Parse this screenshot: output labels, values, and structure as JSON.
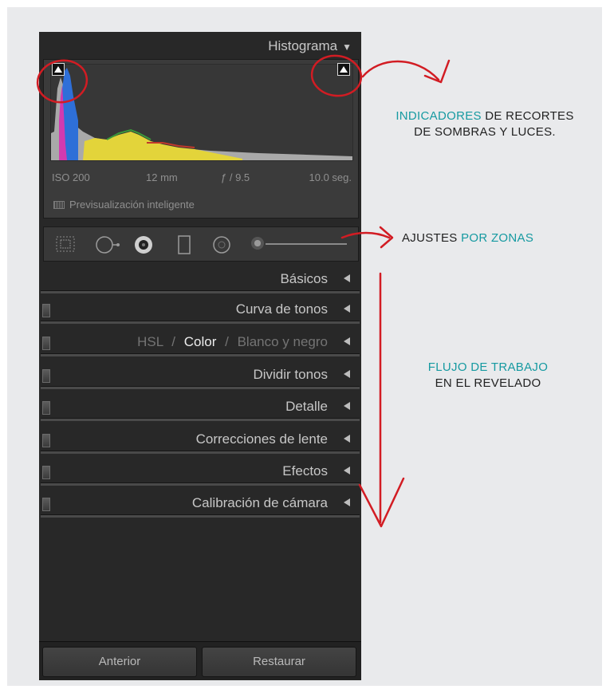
{
  "histogram": {
    "title": "Histograma",
    "exif": {
      "iso": "ISO 200",
      "focal": "12 mm",
      "aperture": "ƒ / 9.5",
      "shutter": "10.0 seg."
    },
    "smart_preview": "Previsualización inteligente"
  },
  "sections": [
    {
      "label": "Básicos"
    },
    {
      "label": "Curva de tonos"
    },
    {
      "hsl_parts": [
        "HSL",
        "/",
        "Color",
        "/",
        "Blanco y negro"
      ]
    },
    {
      "label": "Dividir tonos"
    },
    {
      "label": "Detalle"
    },
    {
      "label": "Correcciones de lente"
    },
    {
      "label": "Efectos"
    },
    {
      "label": "Calibración de cámara"
    }
  ],
  "buttons": {
    "previous": "Anterior",
    "reset": "Restaurar"
  },
  "annotations": {
    "clipping": {
      "highlight": "INDICADORES",
      "rest1": " DE RECORTES",
      "line2": "DE SOMBRAS Y LUCES."
    },
    "zones": {
      "part1": "AJUSTES ",
      "highlight": "POR ZONAS"
    },
    "workflow": {
      "line1": "FLUJO DE TRABAJO",
      "line2": "EN EL REVELADO"
    }
  },
  "colors": {
    "accent": "#169aa1",
    "annotation_red": "#d21c23",
    "panel_bg": "#282828"
  }
}
